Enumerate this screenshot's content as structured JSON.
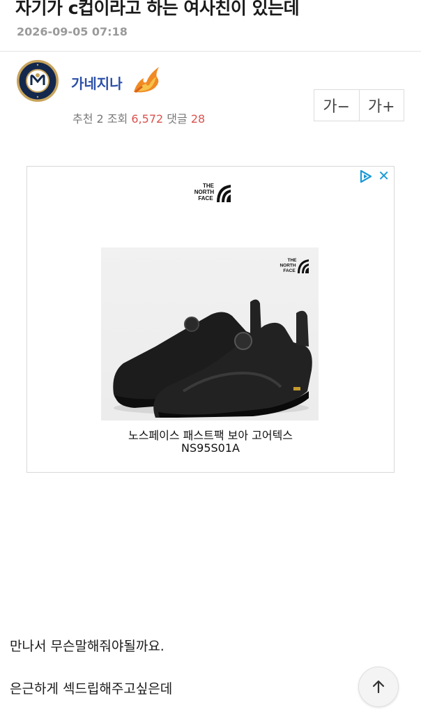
{
  "post": {
    "title": "자기가 c컵이라고 하는 여사친이 있는데",
    "date": "2026-09-05 07:18"
  },
  "author": {
    "name": "가네지나",
    "avatar_icon": "brewers-logo-icon",
    "badge_icon": "flame-icon"
  },
  "stats": {
    "recommend_label": "추천",
    "recommend_count": "2",
    "views_label": "조회",
    "views_count": "6,572",
    "comments_label": "댓글",
    "comments_count": "28"
  },
  "font_controls": {
    "decrease_label": "가−",
    "increase_label": "가+"
  },
  "ad": {
    "brand": "THE NORTH FACE",
    "brand_line1": "THE",
    "brand_line2": "NORTH",
    "brand_line3": "FACE",
    "product_name": "노스페이스 패스트팩 보아 고어텍스",
    "product_code": "NS95S01A",
    "close_symbol": "✕",
    "accent_color": "#1a9ad6"
  },
  "content": {
    "lines": [
      "만나서 무슨말해줘야될까요.",
      "은근하게 섹드립해주고싶은데"
    ]
  },
  "colors": {
    "author_name": "#2b4fa8",
    "stat_number": "#d9534f"
  }
}
